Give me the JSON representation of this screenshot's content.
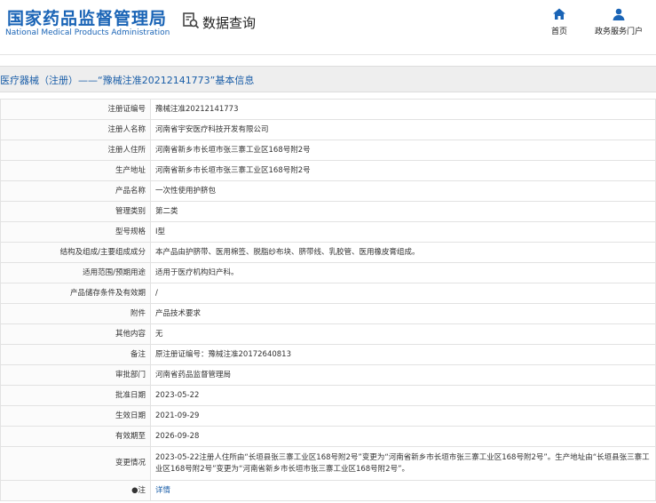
{
  "header": {
    "logo_cn": "国家药品监督管理局",
    "logo_en": "National Medical Products Administration",
    "search_label": "数据查询",
    "nav": [
      {
        "label": "首页",
        "icon": "home-icon"
      },
      {
        "label": "政务服务门户",
        "icon": "user-icon"
      }
    ]
  },
  "title": "医疗器械（注册）——“豫械注准20212141773”基本信息",
  "rows": [
    {
      "key": "注册证编号",
      "value": "豫械注准20212141773"
    },
    {
      "key": "注册人名称",
      "value": "河南省宇安医疗科技开发有限公司"
    },
    {
      "key": "注册人住所",
      "value": "河南省新乡市长垣市张三寨工业区168号附2号"
    },
    {
      "key": "生产地址",
      "value": "河南省新乡市长垣市张三寨工业区168号附2号"
    },
    {
      "key": "产品名称",
      "value": "一次性使用护脐包"
    },
    {
      "key": "管理类别",
      "value": "第二类"
    },
    {
      "key": "型号规格",
      "value": "Ⅰ型"
    },
    {
      "key": "结构及组成/主要组成成分",
      "value": "本产品由护脐带、医用棉签、脱脂纱布块、脐带线、乳胶管、医用橡皮膏组成。"
    },
    {
      "key": "适用范围/预期用途",
      "value": "适用于医疗机构妇产科。"
    },
    {
      "key": "产品储存条件及有效期",
      "value": "/"
    },
    {
      "key": "附件",
      "value": "产品技术要求"
    },
    {
      "key": "其他内容",
      "value": "无"
    },
    {
      "key": "备注",
      "value": "原注册证编号：豫械注准20172640813"
    },
    {
      "key": "审批部门",
      "value": "河南省药品监督管理局"
    },
    {
      "key": "批准日期",
      "value": "2023-05-22"
    },
    {
      "key": "生效日期",
      "value": "2021-09-29"
    },
    {
      "key": "有效期至",
      "value": "2026-09-28"
    },
    {
      "key": "变更情况",
      "value": "2023-05-22注册人住所由“长垣县张三寨工业区168号附2号”变更为“河南省新乡市长垣市张三寨工业区168号附2号”。生产地址由“长垣县张三寨工业区168号附2号”变更为“河南省新乡市长垣市张三寨工业区168号附2号”。"
    },
    {
      "key": "●注",
      "value": "详情",
      "link": true
    }
  ]
}
